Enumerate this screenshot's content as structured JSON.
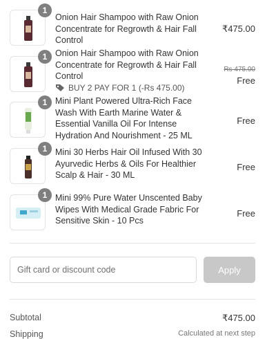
{
  "cart": {
    "items": [
      {
        "quantity": "1",
        "name": "Onion Hair Shampoo with Raw Onion Concentrate for Regrowth & Hair Fall Control",
        "price": "₹475.00",
        "image_icon": "shampoo-bottle-icon"
      },
      {
        "quantity": "1",
        "name": "Onion Hair Shampoo with Raw Onion Concentrate for Regrowth & Hair Fall Control",
        "original_price": "Rs 475.00",
        "price": "Free",
        "promo_icon": "tag-icon",
        "promo_text": "BUY 2 PAY FOR 1 (-Rs 475.00)",
        "image_icon": "shampoo-bottle-icon"
      },
      {
        "quantity": "1",
        "name": "Mini Plant Powered Ultra-Rich Face Wash With Earth Marine Water & Essential Vanilla Oil For Intense Hydration And Nourishment - 25 ML",
        "price": "Free",
        "image_icon": "face-wash-tube-icon"
      },
      {
        "quantity": "1",
        "name": "Mini 30 Herbs Hair Oil Infused With 30 Ayurvedic Herbs & Oils For Healthier Scalp & Hair - 30 ML",
        "price": "Free",
        "image_icon": "hair-oil-bottle-icon"
      },
      {
        "quantity": "1",
        "name": "Mini 99% Pure Water Unscented Baby Wipes With Medical Grade Fabric For Sensitive Skin - 10 Pcs",
        "price": "Free",
        "image_icon": "baby-wipes-pack-icon"
      }
    ]
  },
  "discount": {
    "placeholder": "Gift card or discount code",
    "apply_label": "Apply"
  },
  "summary": {
    "subtotal_label": "Subtotal",
    "subtotal_value": "₹475.00",
    "shipping_label": "Shipping",
    "shipping_value": "Calculated at next step"
  },
  "colors": {
    "badge": "#7f7f7f",
    "apply_button_disabled": "#c8c8c8",
    "divider": "#e3e3e3",
    "bottle_dark": "#5a2a33"
  }
}
